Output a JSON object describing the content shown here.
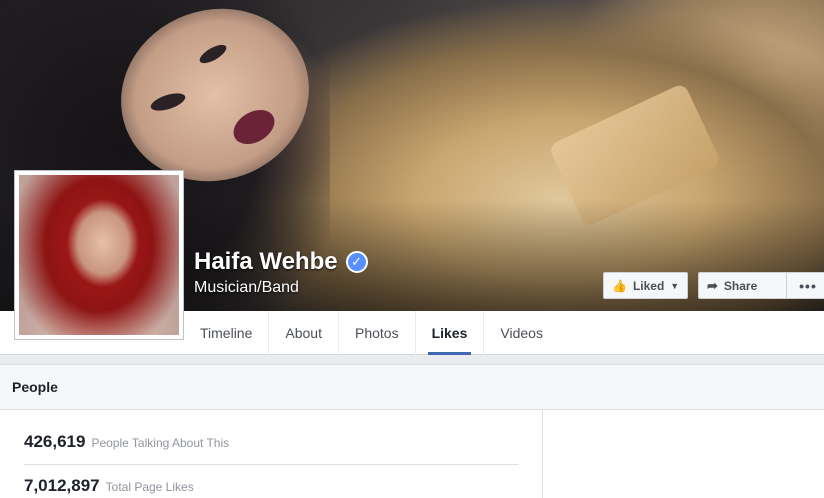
{
  "page": {
    "name": "Haifa Wehbe",
    "category": "Musician/Band",
    "verified_glyph": "✓"
  },
  "actions": {
    "liked_label": "Liked",
    "share_label": "Share",
    "more_label": "•••"
  },
  "tabs": [
    {
      "label": "Timeline",
      "active": false
    },
    {
      "label": "About",
      "active": false
    },
    {
      "label": "Photos",
      "active": false
    },
    {
      "label": "Likes",
      "active": true
    },
    {
      "label": "Videos",
      "active": false
    }
  ],
  "people": {
    "title": "People",
    "talking_count": "426,619",
    "talking_label": "People Talking About This",
    "likes_count": "7,012,897",
    "likes_label": "Total Page Likes"
  },
  "colors": {
    "accent": "#4267b2",
    "verified": "#5890ff"
  },
  "icons": {
    "liked": "thumbs-up-icon",
    "share": "share-arrow-icon",
    "verified": "verified-badge-icon"
  }
}
